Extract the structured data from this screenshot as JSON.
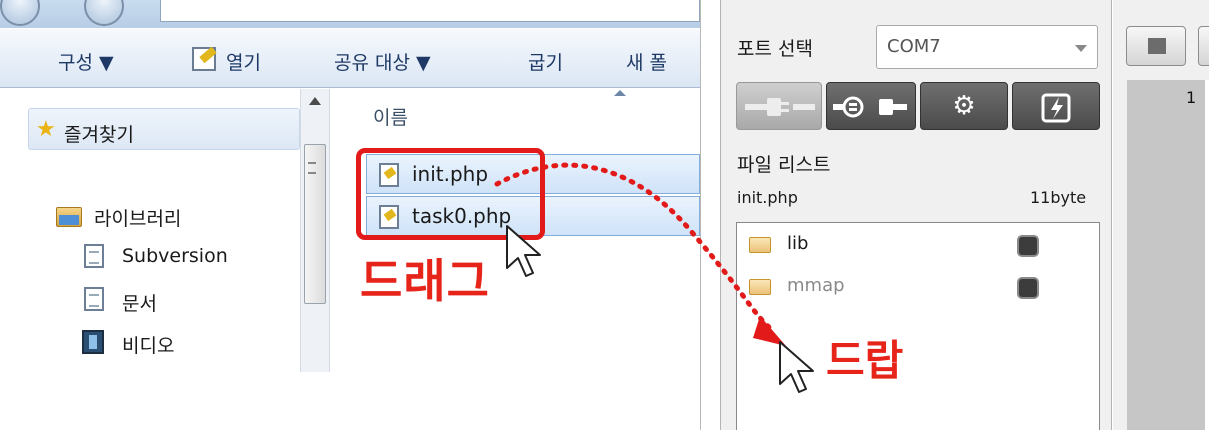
{
  "explorer": {
    "toolbar": {
      "organize": "구성 ▼",
      "open": "열기",
      "share": "공유 대상 ▼",
      "burn": "굽기",
      "new_folder": "새 폴"
    },
    "nav": {
      "favorites": "즐겨찾기",
      "libraries": "라이브러리",
      "subversion": "Subversion",
      "documents": "문서",
      "videos": "비디오"
    },
    "content": {
      "column_name": "이름",
      "files": [
        {
          "name": "init.php"
        },
        {
          "name": "task0.php"
        }
      ]
    }
  },
  "annotations": {
    "drag": "드래그",
    "drop": "드랍",
    "accent_color": "#e6241a"
  },
  "tool": {
    "port_label": "포트 선택",
    "port_value": "COM7",
    "buttons": [
      {
        "icon": "connect-plug-icon",
        "state": "disabled"
      },
      {
        "icon": "disconnect-plug-icon",
        "state": "enabled"
      },
      {
        "icon": "gear-icon",
        "state": "enabled"
      },
      {
        "icon": "chip-flash-icon",
        "state": "enabled"
      }
    ],
    "file_list_label": "파일 리스트",
    "selected_file": "init.php",
    "selected_size": "11byte",
    "list": [
      {
        "name": "lib",
        "color": "#1a1a1a"
      },
      {
        "name": "mmap",
        "color": "#8a8a8a"
      }
    ]
  },
  "editor": {
    "line_number": "1"
  }
}
